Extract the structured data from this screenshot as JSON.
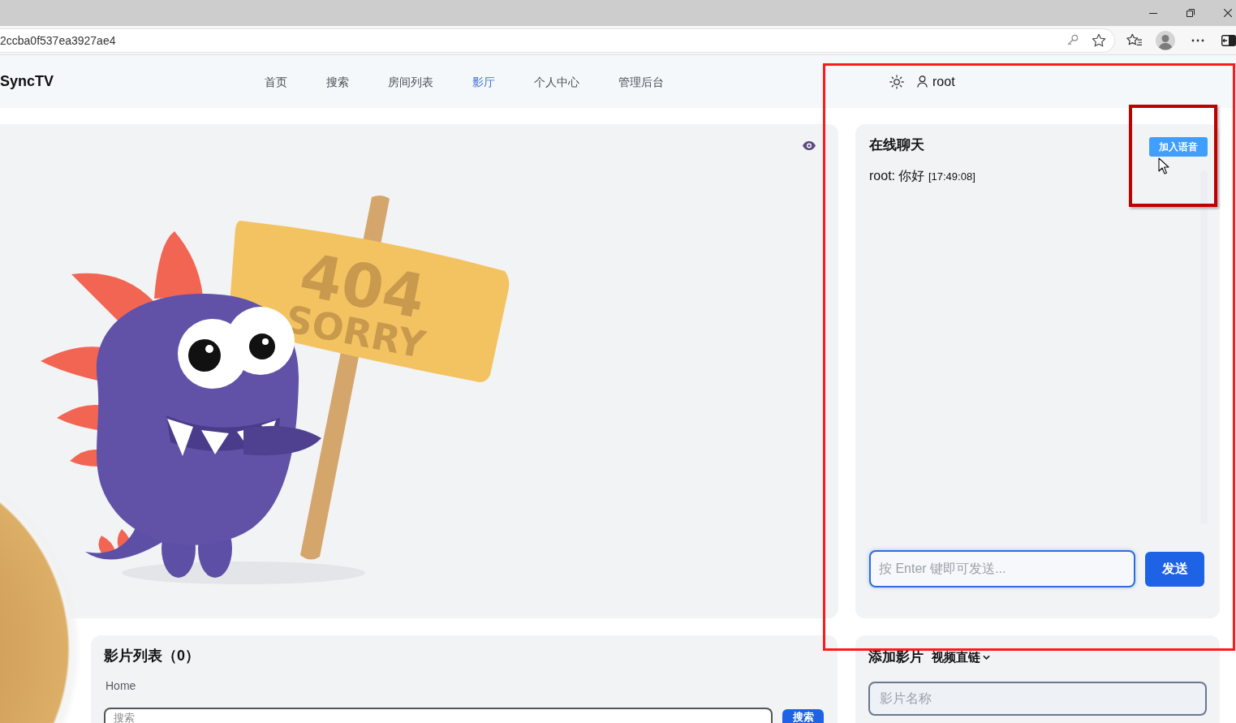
{
  "browser": {
    "url": "2ccba0f537ea3927ae4"
  },
  "nav": {
    "brand": "SyncTV",
    "items": [
      {
        "label": "首页",
        "selected": false
      },
      {
        "label": "搜索",
        "selected": false
      },
      {
        "label": "房间列表",
        "selected": false
      },
      {
        "label": "影厅",
        "selected": true
      },
      {
        "label": "个人中心",
        "selected": false
      },
      {
        "label": "管理后台",
        "selected": false
      }
    ],
    "user": "root"
  },
  "player": {
    "sign": {
      "lines": [
        "404",
        "SORRY"
      ]
    }
  },
  "chat": {
    "title": "在线聊天",
    "voice_button": "加入语音",
    "messages": [
      {
        "text": "root: 你好",
        "time": "[17:49:08]"
      }
    ],
    "input": {
      "placeholder": "按 Enter 键即可发送..."
    },
    "send_button": "发送"
  },
  "movie_list": {
    "title": "影片列表（0）",
    "breadcrumb": "Home",
    "search": {
      "placeholder": "搜索"
    },
    "search_button": "搜索"
  },
  "add_movie": {
    "title": "添加影片",
    "source": "视频直链",
    "name_field": {
      "placeholder": "影片名称"
    }
  }
}
